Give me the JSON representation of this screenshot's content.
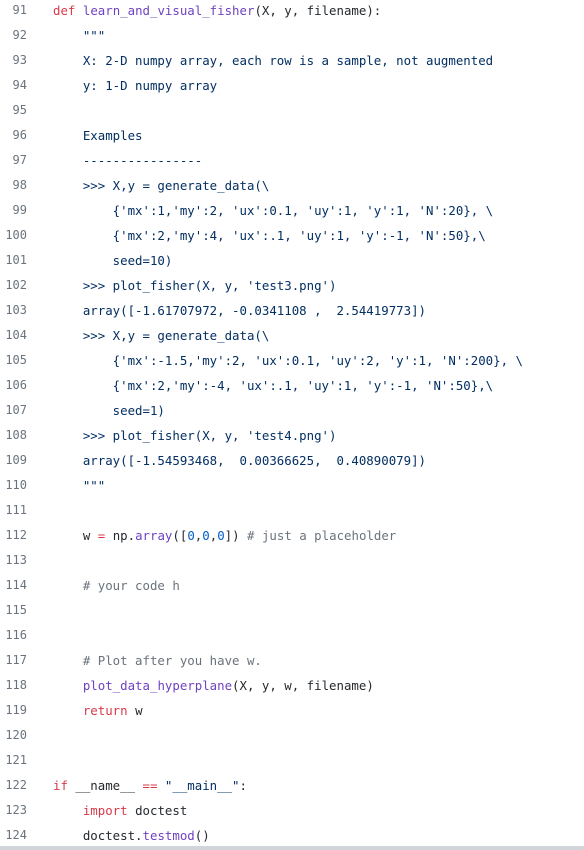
{
  "file_view": {
    "colors": {
      "keyword": "#d73a49",
      "function": "#6f42c1",
      "string": "#032f62",
      "number": "#005cc5",
      "comment": "#6a737d",
      "text": "#24292e",
      "line_number": "#6a737d"
    },
    "lines": [
      {
        "n": "91",
        "tokens": [
          [
            "kw",
            "def"
          ],
          [
            "tx",
            " "
          ],
          [
            "fn",
            "learn_and_visual_fisher"
          ],
          [
            "tx",
            "(X, y, filename):"
          ]
        ]
      },
      {
        "n": "92",
        "tokens": [
          [
            "str",
            "    \"\"\""
          ]
        ]
      },
      {
        "n": "93",
        "tokens": [
          [
            "str",
            "    X: 2-D numpy array, each row is a sample, not augmented"
          ]
        ]
      },
      {
        "n": "94",
        "tokens": [
          [
            "str",
            "    y: 1-D numpy array"
          ]
        ]
      },
      {
        "n": "95",
        "tokens": []
      },
      {
        "n": "96",
        "tokens": [
          [
            "str",
            "    Examples"
          ]
        ]
      },
      {
        "n": "97",
        "tokens": [
          [
            "str",
            "    ----------------"
          ]
        ]
      },
      {
        "n": "98",
        "tokens": [
          [
            "str",
            "    >>> X,y = generate_data(\\"
          ]
        ]
      },
      {
        "n": "99",
        "tokens": [
          [
            "str",
            "        {'mx':1,'my':2, 'ux':0.1, 'uy':1, 'y':1, 'N':20}, \\"
          ]
        ]
      },
      {
        "n": "100",
        "tokens": [
          [
            "str",
            "        {'mx':2,'my':4, 'ux':.1, 'uy':1, 'y':-1, 'N':50},\\"
          ]
        ]
      },
      {
        "n": "101",
        "tokens": [
          [
            "str",
            "        seed=10)"
          ]
        ]
      },
      {
        "n": "102",
        "tokens": [
          [
            "str",
            "    >>> plot_fisher(X, y, 'test3.png')"
          ]
        ]
      },
      {
        "n": "103",
        "tokens": [
          [
            "str",
            "    array([-1.61707972, -0.0341108 ,  2.54419773])"
          ]
        ]
      },
      {
        "n": "104",
        "tokens": [
          [
            "str",
            "    >>> X,y = generate_data(\\"
          ]
        ]
      },
      {
        "n": "105",
        "tokens": [
          [
            "str",
            "        {'mx':-1.5,'my':2, 'ux':0.1, 'uy':2, 'y':1, 'N':200}, \\"
          ]
        ]
      },
      {
        "n": "106",
        "tokens": [
          [
            "str",
            "        {'mx':2,'my':-4, 'ux':.1, 'uy':1, 'y':-1, 'N':50},\\"
          ]
        ]
      },
      {
        "n": "107",
        "tokens": [
          [
            "str",
            "        seed=1)"
          ]
        ]
      },
      {
        "n": "108",
        "tokens": [
          [
            "str",
            "    >>> plot_fisher(X, y, 'test4.png')"
          ]
        ]
      },
      {
        "n": "109",
        "tokens": [
          [
            "str",
            "    array([-1.54593468,  0.00366625,  0.40890079])"
          ]
        ]
      },
      {
        "n": "110",
        "tokens": [
          [
            "str",
            "    \"\"\""
          ]
        ]
      },
      {
        "n": "111",
        "tokens": []
      },
      {
        "n": "112",
        "tokens": [
          [
            "tx",
            "    w "
          ],
          [
            "op",
            "="
          ],
          [
            "tx",
            " np."
          ],
          [
            "fn",
            "array"
          ],
          [
            "tx",
            "(["
          ],
          [
            "num",
            "0"
          ],
          [
            "tx",
            ","
          ],
          [
            "num",
            "0"
          ],
          [
            "tx",
            ","
          ],
          [
            "num",
            "0"
          ],
          [
            "tx",
            "]) "
          ],
          [
            "cm",
            "# just a placeholder"
          ]
        ]
      },
      {
        "n": "113",
        "tokens": []
      },
      {
        "n": "114",
        "tokens": [
          [
            "cm",
            "    # your code h"
          ]
        ]
      },
      {
        "n": "115",
        "tokens": []
      },
      {
        "n": "116",
        "tokens": []
      },
      {
        "n": "117",
        "tokens": [
          [
            "cm",
            "    # Plot after you have w."
          ]
        ]
      },
      {
        "n": "118",
        "tokens": [
          [
            "tx",
            "    "
          ],
          [
            "fn",
            "plot_data_hyperplane"
          ],
          [
            "tx",
            "(X, y, w, filename)"
          ]
        ]
      },
      {
        "n": "119",
        "tokens": [
          [
            "tx",
            "    "
          ],
          [
            "kw",
            "return"
          ],
          [
            "tx",
            " w"
          ]
        ]
      },
      {
        "n": "120",
        "tokens": []
      },
      {
        "n": "121",
        "tokens": []
      },
      {
        "n": "122",
        "tokens": [
          [
            "kw",
            "if"
          ],
          [
            "tx",
            " __name__ "
          ],
          [
            "op",
            "=="
          ],
          [
            "tx",
            " "
          ],
          [
            "str",
            "\"__main__\""
          ],
          [
            "tx",
            ":"
          ]
        ]
      },
      {
        "n": "123",
        "tokens": [
          [
            "tx",
            "    "
          ],
          [
            "kw",
            "import"
          ],
          [
            "tx",
            " doctest"
          ]
        ]
      },
      {
        "n": "124",
        "tokens": [
          [
            "tx",
            "    doctest."
          ],
          [
            "fn",
            "testmod"
          ],
          [
            "tx",
            "()"
          ]
        ]
      }
    ]
  }
}
